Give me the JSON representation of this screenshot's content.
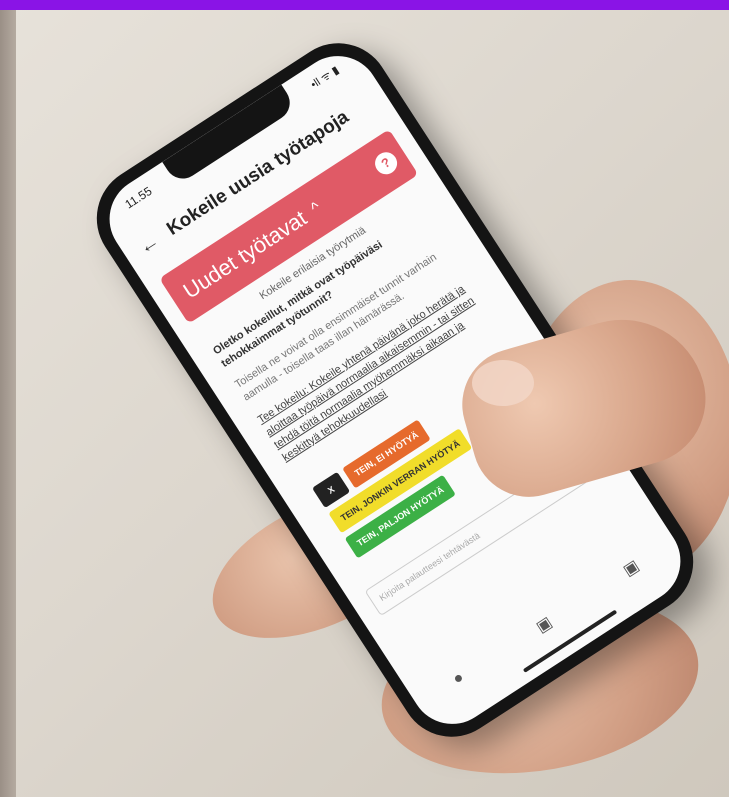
{
  "status": {
    "time": "11.55",
    "signal": "•ll ᯤ ▮"
  },
  "header": {
    "back": "←",
    "title": "Kokeile uusia työtapoja"
  },
  "card": {
    "title": "Uudet työtavat",
    "chevron": "^",
    "help": "?"
  },
  "content": {
    "intro": "Kokeile erilaisia työrytmiä",
    "question": "Oletko kokeillut, mitkä ovat työpäiväsi tehokkaimmat työtunnit?",
    "note": "Toisella ne voivat olla ensimmäiset tunnit varhain aamulla - toisella taas illan hämärässä.",
    "link": "Tee kokeilu: Kokeile yhtenä päivänä joko herätä ja aloittaa työpäivä normaalia aikaisemmin - tai sitten tehdä töitä normaalia myöhemmäksi aikaan ja keskittyä tehokkuudellasi"
  },
  "buttons": {
    "x": "X",
    "b1": "TEIN, EI HYÖTYÄ",
    "b2": "TEIN, JONKIN VERRAN HYÖTYÄ",
    "b3": "TEIN, PALJON HYÖTYÄ"
  },
  "input": {
    "placeholder": "Kirjoita palautteesi tehtävästä"
  },
  "menu_icon": "≡",
  "bottom": [
    "●",
    "▣",
    "▣"
  ]
}
